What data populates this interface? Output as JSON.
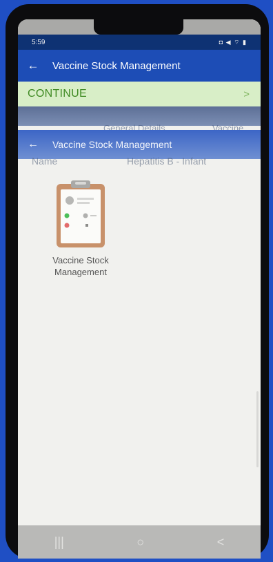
{
  "status_bar": {
    "time": "5:59",
    "icons": "◘ ◀ ⌔ ▮"
  },
  "app_bar": {
    "back_icon": "arrow-left-icon",
    "title": "Vaccine Stock Management"
  },
  "continue_bar": {
    "label": "CONTINUE",
    "chevron": ">"
  },
  "ghost_header": {
    "tabs": [
      "General Details",
      "Vaccine"
    ],
    "title": "Vaccine Stock Management",
    "row_left": "Name",
    "row_right": "Hepatitis B - Infant"
  },
  "tile": {
    "label": "Vaccine Stock Management"
  },
  "nav_bar": {
    "recents": "|||",
    "home": "○",
    "back": "<"
  },
  "colors": {
    "background": "#1f4fc4",
    "app_bar": "#1d4db6",
    "status_bar": "#0e3273",
    "continue_bg": "#d8eec7",
    "continue_text": "#3f8a23",
    "clipboard": "#c8916a"
  }
}
